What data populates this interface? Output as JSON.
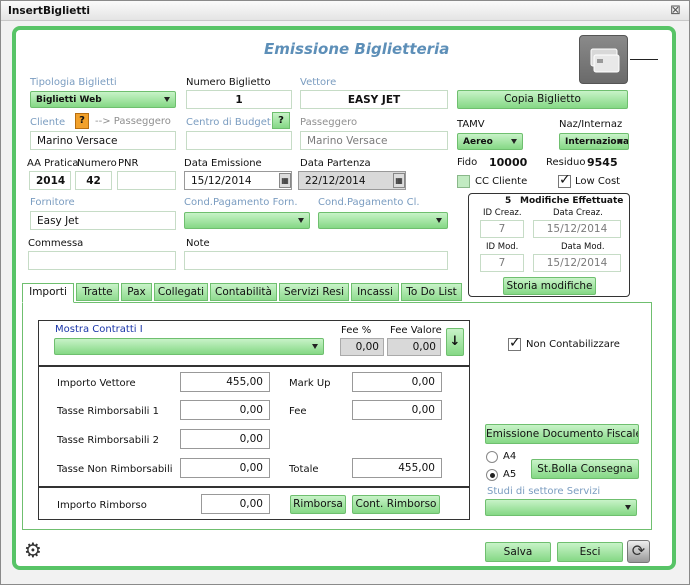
{
  "window": {
    "title": "InsertBiglietti",
    "close_icon": "close-icon"
  },
  "header": {
    "title": "Emissione Biglietteria",
    "card_icon": "credit-card-icon"
  },
  "tipologia": {
    "label": "Tipologia Biglietti",
    "value": "Biglietti Web"
  },
  "numero": {
    "label": "Numero Biglietto",
    "value": "1"
  },
  "vettore": {
    "label": "Vettore",
    "value": "EASY JET"
  },
  "copia_label": "Copia Biglietto",
  "cliente": {
    "label": "Cliente",
    "q": "?",
    "passeggero_link": "--> Passeggero",
    "value": "Marino Versace"
  },
  "centro": {
    "label": "Centro di Budget",
    "q": "?",
    "value": ""
  },
  "passeggero": {
    "label": "Passeggero",
    "value": "Marino Versace"
  },
  "tamv": {
    "label": "TAMV",
    "value": "Aereo"
  },
  "naz": {
    "label": "Naz/Internaz",
    "value": "Internazional"
  },
  "aa_pratica": {
    "label": "AA Pratica",
    "value": "2014"
  },
  "numero_pratica": {
    "label": "Numero",
    "value": "42"
  },
  "pnr": {
    "label": "PNR",
    "value": ""
  },
  "data_emissione": {
    "label": "Data Emissione",
    "value": "15/12/2014"
  },
  "data_partenza": {
    "label": "Data Partenza",
    "value": "22/12/2014"
  },
  "fido": {
    "label": "Fido",
    "value": "10000"
  },
  "residuo": {
    "label": "Residuo",
    "value": "9545"
  },
  "cc_cliente_label": "CC Cliente",
  "low_cost_label": "Low Cost",
  "fornitore": {
    "label": "Fornitore",
    "value": "Easy Jet"
  },
  "cond_forn_label": "Cond.Pagamento Forn.",
  "cond_cl_label": "Cond.Pagamento Cl.",
  "modifiche": {
    "count": "5",
    "title": "Modifiche Effettuate",
    "id_creaz_label": "ID Creaz.",
    "id_creaz": "7",
    "data_creaz_label": "Data Creaz.",
    "data_creaz": "15/12/2014",
    "id_mod_label": "ID Mod.",
    "id_mod": "7",
    "data_mod_label": "Data Mod.",
    "data_mod": "15/12/2014",
    "storia_label": "Storia modifiche"
  },
  "commessa": {
    "label": "Commessa",
    "value": ""
  },
  "note": {
    "label": "Note",
    "value": ""
  },
  "tabs": [
    "Importi",
    "Tratte",
    "Pax",
    "Collegati",
    "Contabilità",
    "Servizi Resi",
    "Incassi",
    "To Do List"
  ],
  "contratti": {
    "label": "Mostra Contratti I",
    "fee_pct_label": "Fee %",
    "fee_valore_label": "Fee Valore",
    "fee_pct": "0,00",
    "fee_valore": "0,00",
    "down_icon": "arrow-down-icon"
  },
  "non_contabilizzare_label": "Non Contabilizzare",
  "importi": {
    "vettore_label": "Importo Vettore",
    "vettore": "455,00",
    "markup_label": "Mark Up",
    "markup": "0,00",
    "tasse1_label": "Tasse Rimborsabili 1",
    "tasse1": "0,00",
    "fee_label": "Fee",
    "fee": "0,00",
    "tasse2_label": "Tasse Rimborsabili 2",
    "tasse2": "0,00",
    "tasse_non_label": "Tasse Non Rimborsabili",
    "tasse_non": "0,00",
    "totale_label": "Totale",
    "totale": "455,00"
  },
  "rimborso": {
    "label": "Importo Rimborso",
    "value": "0,00",
    "rimborsa_label": "Rimborsa",
    "cont_label": "Cont. Rimborso"
  },
  "emissione_doc_label": "Emissione Documento Fiscale",
  "formato": {
    "a4": "A4",
    "a5": "A5",
    "selected": "A5"
  },
  "bolla_label": "St.Bolla Consegna",
  "studi_label": "Studi di settore Servizi",
  "salva_label": "Salva",
  "esci_label": "Esci",
  "settings_icon": "gear-icon",
  "refresh_icon": "refresh-icon"
}
